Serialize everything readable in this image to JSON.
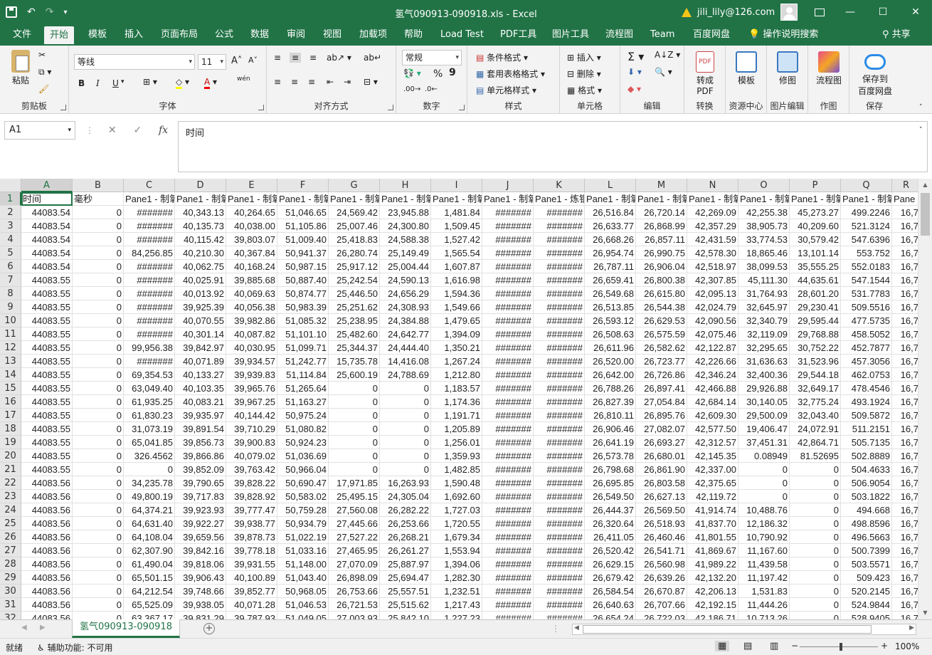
{
  "titlebar": {
    "title": "氢气090913-090918.xls  -  Excel",
    "user": "jili_lily@126.com",
    "qat": [
      "save-icon",
      "undo-icon",
      "redo-icon",
      "customize-icon"
    ],
    "win": [
      "—",
      "☐",
      "✕"
    ]
  },
  "tabs": [
    "文件",
    "开始",
    "模板",
    "插入",
    "页面布局",
    "公式",
    "数据",
    "审阅",
    "视图",
    "加载项",
    "帮助",
    "Load Test",
    "PDF工具",
    "图片工具",
    "流程图",
    "Team",
    "百度网盘",
    "操作说明搜索",
    "共享"
  ],
  "ribbon": {
    "paste": "粘贴",
    "clipboard": "剪贴板",
    "font_name": "等线",
    "font_size": "11",
    "font": "字体",
    "align": "对齐方式",
    "num_format": "常规",
    "number": "数字",
    "cond_format": "条件格式",
    "table_format": "套用表格格式",
    "cell_style": "单元格样式",
    "styles": "样式",
    "insert": "插入",
    "delete": "删除",
    "format": "格式",
    "cells": "单元格",
    "edit": "编辑",
    "to_pdf": "转成\nPDF",
    "convert": "转换",
    "template": "模板",
    "resource": "资源中心",
    "fix_image": "修图",
    "image_edit": "图片编辑",
    "flowchart": "流程图",
    "draw": "作图",
    "save_to": "保存到\n百度网盘",
    "save": "保存",
    "bold": "B",
    "italic": "I",
    "underline": "U",
    "percent": "%",
    "comma": "9",
    "wen": "wén"
  },
  "formula": {
    "name_box": "A1",
    "content": "时间",
    "fx": "fx",
    "cancel": "✕",
    "enter": "✓"
  },
  "columns": [
    "A",
    "B",
    "C",
    "D",
    "E",
    "F",
    "G",
    "H",
    "I",
    "J",
    "K",
    "L",
    "M",
    "N",
    "O",
    "P",
    "Q",
    "R"
  ],
  "rows": [
    [
      "1",
      "时间",
      "毫秒",
      "Pane1 - 制氧",
      "Pane1 - 制氧",
      "Pane1 - 制氧",
      "Pane1 - 制氧",
      "Pane1 - 制氧",
      "Pane1 - 制氧",
      "Pane1 - 制氧",
      "Pane1 - 制氧",
      "Pane1 - 炼钢",
      "Pane1 - 制氧",
      "Pane1 - 制氧",
      "Pane1 - 制氧",
      "Pane1 - 制氧",
      "Pane1 - 制氧",
      "Pane1 - 制氧",
      "Pane"
    ],
    [
      "2",
      "44083.54",
      "0",
      "#######",
      "40,343.13",
      "40,264.65",
      "51,046.65",
      "24,569.42",
      "23,945.88",
      "1,481.84",
      "#######",
      "#######",
      "26,516.84",
      "26,720.14",
      "42,269.09",
      "42,255.38",
      "45,273.27",
      "499.2246",
      "16,7"
    ],
    [
      "3",
      "44083.54",
      "0",
      "#######",
      "40,135.73",
      "40,038.00",
      "51,105.86",
      "25,007.46",
      "24,300.80",
      "1,509.45",
      "#######",
      "#######",
      "26,633.77",
      "26,868.99",
      "42,357.29",
      "38,905.73",
      "40,209.60",
      "521.3124",
      "16,7"
    ],
    [
      "4",
      "44083.54",
      "0",
      "#######",
      "40,115.42",
      "39,803.07",
      "51,009.40",
      "25,418.83",
      "24,588.38",
      "1,527.42",
      "#######",
      "#######",
      "26,668.26",
      "26,857.11",
      "42,431.59",
      "33,774.53",
      "30,579.42",
      "547.6396",
      "16,7"
    ],
    [
      "5",
      "44083.54",
      "0",
      "84,256.85",
      "40,210.30",
      "40,367.84",
      "50,941.37",
      "26,280.74",
      "25,149.49",
      "1,565.54",
      "#######",
      "#######",
      "26,954.74",
      "26,990.75",
      "42,578.30",
      "18,865.46",
      "13,101.14",
      "553.752",
      "16,7"
    ],
    [
      "6",
      "44083.54",
      "0",
      "#######",
      "40,062.75",
      "40,168.24",
      "50,987.15",
      "25,917.12",
      "25,004.44",
      "1,607.87",
      "#######",
      "#######",
      "26,787.11",
      "26,906.04",
      "42,518.97",
      "38,099.53",
      "35,555.25",
      "552.0183",
      "16,7"
    ],
    [
      "7",
      "44083.55",
      "0",
      "#######",
      "40,025.91",
      "39,885.68",
      "50,887.40",
      "25,242.54",
      "24,590.13",
      "1,616.98",
      "#######",
      "#######",
      "26,659.41",
      "26,800.38",
      "42,307.85",
      "45,111.30",
      "44,635.61",
      "547.1544",
      "16,7"
    ],
    [
      "8",
      "44083.55",
      "0",
      "#######",
      "40,013.92",
      "40,069.63",
      "50,874.77",
      "25,446.50",
      "24,656.29",
      "1,594.36",
      "#######",
      "#######",
      "26,549.68",
      "26,615.80",
      "42,095.13",
      "31,764.93",
      "28,601.20",
      "531.7783",
      "16,7"
    ],
    [
      "9",
      "44083.55",
      "0",
      "#######",
      "39,925.39",
      "40,056.38",
      "50,983.39",
      "25,251.62",
      "24,308.93",
      "1,549.66",
      "#######",
      "#######",
      "26,513.85",
      "26,544.38",
      "42,024.79",
      "32,645.97",
      "29,230.41",
      "509.5516",
      "16,7"
    ],
    [
      "10",
      "44083.55",
      "0",
      "#######",
      "40,070.55",
      "39,982.86",
      "51,085.32",
      "25,238.95",
      "24,384.88",
      "1,479.65",
      "#######",
      "#######",
      "26,593.12",
      "26,629.53",
      "42,090.56",
      "32,340.79",
      "29,595.44",
      "477.5735",
      "16,7"
    ],
    [
      "11",
      "44083.55",
      "0",
      "#######",
      "40,301.14",
      "40,087.82",
      "51,101.10",
      "25,482.60",
      "24,642.77",
      "1,394.09",
      "#######",
      "#######",
      "26,508.63",
      "26,575.59",
      "42,075.46",
      "32,119.09",
      "29,768.88",
      "458.5052",
      "16,7"
    ],
    [
      "12",
      "44083.55",
      "0",
      "99,956.38",
      "39,842.97",
      "40,030.95",
      "51,099.71",
      "25,344.37",
      "24,444.40",
      "1,350.21",
      "#######",
      "#######",
      "26,611.96",
      "26,582.62",
      "42,122.87",
      "32,295.65",
      "30,752.22",
      "452.7877",
      "16,7"
    ],
    [
      "13",
      "44083.55",
      "0",
      "#######",
      "40,071.89",
      "39,934.57",
      "51,242.77",
      "15,735.78",
      "14,416.08",
      "1,267.24",
      "#######",
      "#######",
      "26,520.00",
      "26,723.77",
      "42,226.66",
      "31,636.63",
      "31,523.96",
      "457.3056",
      "16,7"
    ],
    [
      "14",
      "44083.55",
      "0",
      "69,354.53",
      "40,133.27",
      "39,939.83",
      "51,114.84",
      "25,600.19",
      "24,788.69",
      "1,212.80",
      "#######",
      "#######",
      "26,642.00",
      "26,726.86",
      "42,346.24",
      "32,400.36",
      "29,544.18",
      "462.0753",
      "16,7"
    ],
    [
      "15",
      "44083.55",
      "0",
      "63,049.40",
      "40,103.35",
      "39,965.76",
      "51,265.64",
      "0",
      "0",
      "1,183.57",
      "#######",
      "#######",
      "26,788.26",
      "26,897.41",
      "42,466.88",
      "29,926.88",
      "32,649.17",
      "478.4546",
      "16,7"
    ],
    [
      "16",
      "44083.55",
      "0",
      "61,935.25",
      "40,083.21",
      "39,967.25",
      "51,163.27",
      "0",
      "0",
      "1,174.36",
      "#######",
      "#######",
      "26,827.39",
      "27,054.84",
      "42,684.14",
      "30,140.05",
      "32,775.24",
      "493.1924",
      "16,7"
    ],
    [
      "17",
      "44083.55",
      "0",
      "61,830.23",
      "39,935.97",
      "40,144.42",
      "50,975.24",
      "0",
      "0",
      "1,191.71",
      "#######",
      "#######",
      "26,810.11",
      "26,895.76",
      "42,609.30",
      "29,500.09",
      "32,043.40",
      "509.5872",
      "16,7"
    ],
    [
      "18",
      "44083.55",
      "0",
      "31,073.19",
      "39,891.54",
      "39,710.29",
      "51,080.82",
      "0",
      "0",
      "1,205.89",
      "#######",
      "#######",
      "26,906.46",
      "27,082.07",
      "42,577.50",
      "19,406.47",
      "24,072.91",
      "511.2151",
      "16,7"
    ],
    [
      "19",
      "44083.55",
      "0",
      "65,041.85",
      "39,856.73",
      "39,900.83",
      "50,924.23",
      "0",
      "0",
      "1,256.01",
      "#######",
      "#######",
      "26,641.19",
      "26,693.27",
      "42,312.57",
      "37,451.31",
      "42,864.71",
      "505.7135",
      "16,7"
    ],
    [
      "20",
      "44083.55",
      "0",
      "326.4562",
      "39,866.86",
      "40,079.02",
      "51,036.69",
      "0",
      "0",
      "1,359.93",
      "#######",
      "#######",
      "26,573.78",
      "26,680.01",
      "42,145.35",
      "0.08949",
      "81.52695",
      "502.8889",
      "16,7"
    ],
    [
      "21",
      "44083.55",
      "0",
      "0",
      "39,852.09",
      "39,763.42",
      "50,966.04",
      "0",
      "0",
      "1,482.85",
      "#######",
      "#######",
      "26,798.68",
      "26,861.90",
      "42,337.00",
      "0",
      "0",
      "504.4633",
      "16,7"
    ],
    [
      "22",
      "44083.56",
      "0",
      "34,235.78",
      "39,790.65",
      "39,828.22",
      "50,690.47",
      "17,971.85",
      "16,263.93",
      "1,590.48",
      "#######",
      "#######",
      "26,695.85",
      "26,803.58",
      "42,375.65",
      "0",
      "0",
      "506.9054",
      "16,7"
    ],
    [
      "23",
      "44083.56",
      "0",
      "49,800.19",
      "39,717.83",
      "39,828.92",
      "50,583.02",
      "25,495.15",
      "24,305.04",
      "1,692.60",
      "#######",
      "#######",
      "26,549.50",
      "26,627.13",
      "42,119.72",
      "0",
      "0",
      "503.1822",
      "16,7"
    ],
    [
      "24",
      "44083.56",
      "0",
      "64,374.21",
      "39,923.93",
      "39,777.47",
      "50,759.28",
      "27,560.08",
      "26,282.22",
      "1,727.03",
      "#######",
      "#######",
      "26,444.37",
      "26,569.50",
      "41,914.74",
      "10,488.76",
      "0",
      "494.668",
      "16,7"
    ],
    [
      "25",
      "44083.56",
      "0",
      "64,631.40",
      "39,922.27",
      "39,938.77",
      "50,934.79",
      "27,445.66",
      "26,253.66",
      "1,720.55",
      "#######",
      "#######",
      "26,320.64",
      "26,518.93",
      "41,837.70",
      "12,186.32",
      "0",
      "498.8596",
      "16,7"
    ],
    [
      "26",
      "44083.56",
      "0",
      "64,108.04",
      "39,659.56",
      "39,878.73",
      "51,022.19",
      "27,527.22",
      "26,268.21",
      "1,679.34",
      "#######",
      "#######",
      "26,411.05",
      "26,460.46",
      "41,801.55",
      "10,790.92",
      "0",
      "496.5663",
      "16,7"
    ],
    [
      "27",
      "44083.56",
      "0",
      "62,307.90",
      "39,842.16",
      "39,778.18",
      "51,033.16",
      "27,465.95",
      "26,261.27",
      "1,553.94",
      "#######",
      "#######",
      "26,520.42",
      "26,541.71",
      "41,869.67",
      "11,167.60",
      "0",
      "500.7399",
      "16,7"
    ],
    [
      "28",
      "44083.56",
      "0",
      "61,490.04",
      "39,818.06",
      "39,931.55",
      "51,148.00",
      "27,070.09",
      "25,887.97",
      "1,394.06",
      "#######",
      "#######",
      "26,629.15",
      "26,560.98",
      "41,989.22",
      "11,439.58",
      "0",
      "503.5571",
      "16,7"
    ],
    [
      "29",
      "44083.56",
      "0",
      "65,501.15",
      "39,906.43",
      "40,100.89",
      "51,043.40",
      "26,898.09",
      "25,694.47",
      "1,282.30",
      "#######",
      "#######",
      "26,679.42",
      "26,639.26",
      "42,132.20",
      "11,197.42",
      "0",
      "509.423",
      "16,7"
    ],
    [
      "30",
      "44083.56",
      "0",
      "64,212.54",
      "39,748.66",
      "39,852.77",
      "50,968.05",
      "26,753.66",
      "25,557.51",
      "1,232.51",
      "#######",
      "#######",
      "26,584.54",
      "26,670.87",
      "42,206.13",
      "1,531.83",
      "0",
      "520.2145",
      "16,7"
    ],
    [
      "31",
      "44083.56",
      "0",
      "65,525.09",
      "39,938.05",
      "40,071.28",
      "51,046.53",
      "26,721.53",
      "25,515.62",
      "1,217.43",
      "#######",
      "#######",
      "26,640.63",
      "26,707.66",
      "42,192.15",
      "11,444.26",
      "0",
      "524.9844",
      "16,7"
    ],
    [
      "32",
      "44083.56",
      "0",
      "63,367.17",
      "39,831.29",
      "39,787.93",
      "51,049.05",
      "27,003.93",
      "25,842.10",
      "1,227.23",
      "#######",
      "#######",
      "26,654.24",
      "26,722.03",
      "42,186.71",
      "10,713.26",
      "0",
      "528.9405",
      "16,7"
    ]
  ],
  "sheet": {
    "name": "氢气090913-090918",
    "add": "+"
  },
  "status": {
    "ready": "就绪",
    "accessibility": "辅助功能: 不可用",
    "zoom": "100%",
    "minus": "−",
    "plus": "+"
  }
}
